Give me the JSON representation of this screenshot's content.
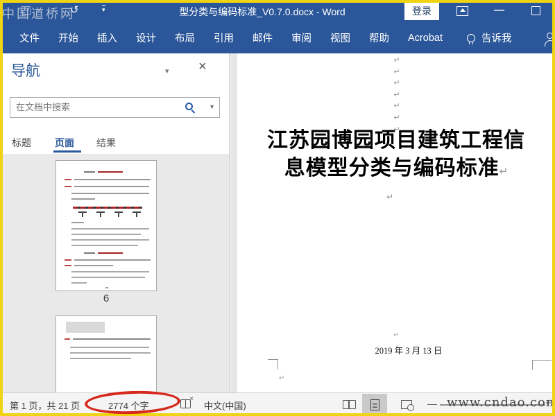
{
  "window": {
    "title": "型分类与编码标准_V0.7.0.docx - Word",
    "sign_in_label": "登录"
  },
  "watermarks": {
    "top_left": "中国道桥网",
    "bottom_right": "www.cndao.com"
  },
  "ribbon": {
    "tabs": [
      "文件",
      "开始",
      "插入",
      "设计",
      "布局",
      "引用",
      "邮件",
      "审阅",
      "视图",
      "帮助",
      "Acrobat"
    ],
    "tell_me_label": "告诉我"
  },
  "nav_pane": {
    "title": "导航",
    "search_placeholder": "在文档中搜索",
    "tabs": [
      {
        "label": "标题",
        "active": false
      },
      {
        "label": "页面",
        "active": true
      },
      {
        "label": "结果",
        "active": false
      }
    ],
    "visible_page_label": "6"
  },
  "document": {
    "title_line1": "江苏园博园项目建筑工程信",
    "title_line2": "息模型分类与编码标准",
    "date": "2019 年 3 月 13 日"
  },
  "status_bar": {
    "page_info": "第 1 页，共 21 页",
    "word_count": "2774 个字",
    "language": "中文(中国)"
  },
  "icons": {
    "undo": "↺",
    "caret_down": "▾",
    "close": "×",
    "minimize": "—",
    "zoom_out": "—",
    "zoom_in": "+",
    "pilcrow": "↵"
  },
  "colors": {
    "accent_blue": "#2B579A",
    "frame_yellow": "#F0D414",
    "annotation_red": "#D6281C"
  }
}
